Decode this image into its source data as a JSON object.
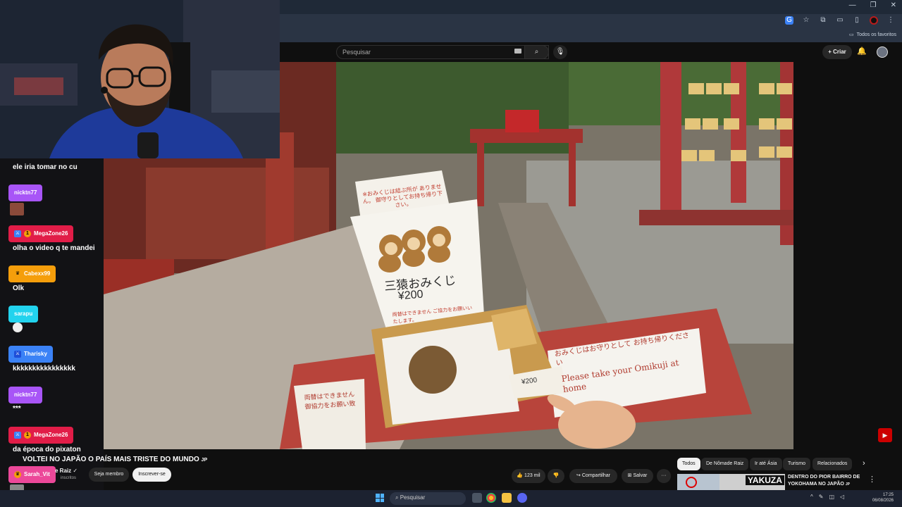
{
  "window": {
    "minimize": "—",
    "restore": "❐",
    "close": "✕"
  },
  "bookmarks": {
    "all_favorites": "Todos os favoritos"
  },
  "youtube": {
    "search_placeholder": "Pesquisar",
    "create_label": "Criar",
    "video_title": "VOLTEI NO JAPÃO O PAÍS MAIS TRISTE DO MUNDO",
    "video_title_tag": "JP",
    "channel_name": "e Raiz",
    "subscribers": "inscritos",
    "join_label": "Seja membro",
    "subscribe_label": "Inscrever-se",
    "like_count": "123 mil",
    "share_label": "Compartilhar",
    "save_label": "Salvar",
    "more_label": "···",
    "chips": [
      "Todos",
      "De Nômade Raiz",
      "Ir até Ásia",
      "Turismo",
      "Relacionados"
    ],
    "rec_title": "DENTRO DO PIOR BAIRRO DE YOKOHAMA NO JAPÃO",
    "rec_title_tag": "JP",
    "rec_thumb_text": "YAKUZA"
  },
  "video_scene": {
    "sign_top": "※おみくじは結ぶ所が ありません。 御守りとしてお持ち帰り下さい。",
    "sign_main": "三猿おみくじ",
    "sign_price": "¥200",
    "sign_small": "両替はできません ご協力をお願いいたします。",
    "box_price": "¥200",
    "right_sign_jp": "おみくじはお守りとして お持ち帰りください",
    "right_sign_en": "Please take your Omikuji at home",
    "left_sign_jp": "両替はできません 御協力をお願い致"
  },
  "chat": {
    "messages": [
      {
        "user": "",
        "text": "ele iria tomar no cu",
        "color": "#1f2937"
      },
      {
        "user": "nicktn77",
        "text": "",
        "color": "#a855f7"
      },
      {
        "user": "MegaZone26",
        "text": "olha o video q te mandei",
        "color": "#e11d48"
      },
      {
        "user": "Cabexx99",
        "text": "Olk",
        "color": "#f59e0b"
      },
      {
        "user": "sarapu",
        "text": "",
        "color": "#22d3ee"
      },
      {
        "user": "Tharisky",
        "text": "kkkkkkkkkkkkkkkk",
        "color": "#3b82f6"
      },
      {
        "user": "nicktn77",
        "text": "***",
        "color": "#a855f7"
      },
      {
        "user": "MegaZone26",
        "text": "da época do pixaton",
        "color": "#e11d48"
      },
      {
        "user": "Sarah_Vit",
        "text": "",
        "color": "#ec4899"
      }
    ]
  },
  "taskbar": {
    "search_placeholder": "Pesquisar",
    "time": "17:25",
    "date": "06/08/2026"
  }
}
